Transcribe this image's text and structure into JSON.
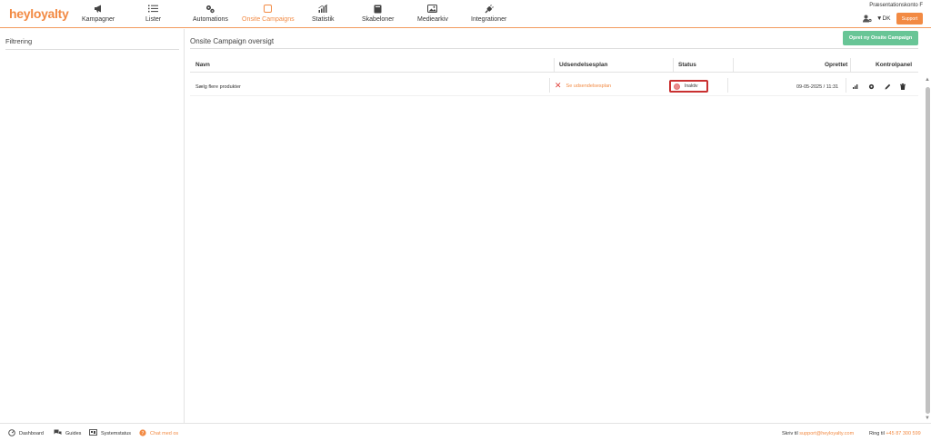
{
  "brand": {
    "logo_text": "heyloyalty",
    "accent": "#f28a43"
  },
  "nav": {
    "items": [
      {
        "label": "Kampagner",
        "icon": "megaphone-icon",
        "active": false
      },
      {
        "label": "Lister",
        "icon": "list-icon",
        "active": false
      },
      {
        "label": "Automations",
        "icon": "automation-icon",
        "active": false
      },
      {
        "label": "Onsite Campaigns",
        "icon": "onsite-icon",
        "active": true
      },
      {
        "label": "Statistik",
        "icon": "bar-chart-icon",
        "active": false
      },
      {
        "label": "Skabeloner",
        "icon": "template-icon",
        "active": false
      },
      {
        "label": "Mediearkiv",
        "icon": "image-icon",
        "active": false
      },
      {
        "label": "Integrationer",
        "icon": "plug-icon",
        "active": false
      }
    ]
  },
  "account": {
    "name": "Præsentationskonto F",
    "language": "DK",
    "support_label": "Support"
  },
  "sidebar": {
    "title": "Filtrering"
  },
  "main": {
    "title": "Onsite Campaign oversigt",
    "new_button": "Opret ny Onsite Campaign",
    "columns": {
      "name": "Navn",
      "schedule": "Udsendelsesplan",
      "status": "Status",
      "created": "Oprettet",
      "controls": "Kontrolpanel"
    },
    "rows": [
      {
        "name": "Sælg flere produkter",
        "schedule": "Se udsendelsesplan",
        "status": "Inaktiv",
        "created": "09-05-2025 / 11:31"
      }
    ]
  },
  "footer": {
    "dashboard": "Dashboard",
    "guides": "Guides",
    "systemstatus": "Systemstatus",
    "chat": "Chat med os",
    "write_prefix": "Skriv til",
    "email": "support@heyloyalty.com",
    "call_prefix": "Ring til",
    "phone": "+45 87 300 599"
  }
}
